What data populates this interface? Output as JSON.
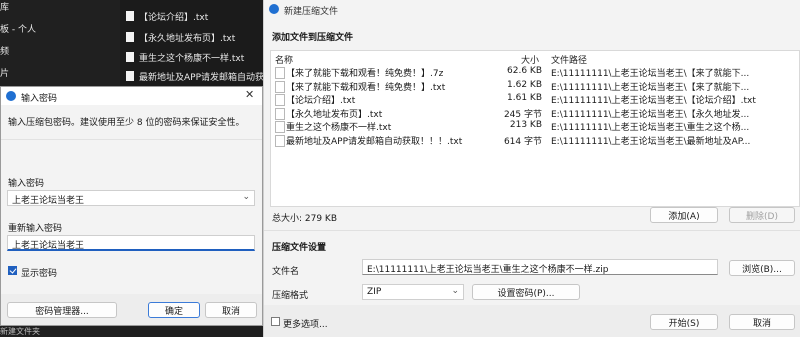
{
  "background": {
    "sidebar_items": [
      "库",
      "板 - 个人",
      "频",
      "片"
    ],
    "files": [
      "【论坛介绍】.txt",
      "【永久地址发布页】.txt",
      "重生之这个杨康不一样.txt",
      "最新地址及APP请发邮箱自动获取!"
    ],
    "status": "新建文件夹"
  },
  "main_dialog": {
    "title": "新建压缩文件",
    "add_section_title": "添加文件到压缩文件",
    "columns": {
      "name": "名称",
      "size": "大小",
      "path": "文件路径"
    },
    "rows": [
      {
        "name": "【来了就能下载和观看！纯免费！】.7z",
        "size": "62.6 KB",
        "path": "E:\\11111111\\上老王论坛当老王\\【来了就能下..."
      },
      {
        "name": "【来了就能下载和观看！纯免费！】.txt",
        "size": "1.62 KB",
        "path": "E:\\11111111\\上老王论坛当老王\\【来了就能下..."
      },
      {
        "name": "【论坛介绍】.txt",
        "size": "1.61 KB",
        "path": "E:\\11111111\\上老王论坛当老王\\【论坛介绍】.txt"
      },
      {
        "name": "【永久地址发布页】.txt",
        "size": "245 字节",
        "path": "E:\\11111111\\上老王论坛当老王\\【永久地址发..."
      },
      {
        "name": "重生之这个杨康不一样.txt",
        "size": "213 KB",
        "path": "E:\\11111111\\上老王论坛当老王\\重生之这个杨..."
      },
      {
        "name": "最新地址及APP请发邮箱自动获取！！！.txt",
        "size": "614 字节",
        "path": "E:\\11111111\\上老王论坛当老王\\最新地址及AP..."
      }
    ],
    "total_size": "总大小: 279 KB",
    "add_button": "添加(A)",
    "delete_button": "删除(D)",
    "settings_title": "压缩文件设置",
    "filename_label": "文件名",
    "filename_value": "E:\\11111111\\上老王论坛当老王\\重生之这个杨康不一样.zip",
    "browse_button": "浏览(B)...",
    "format_label": "压缩格式",
    "format_value": "ZIP",
    "set_password_button": "设置密码(P)...",
    "more_options": "更多选项...",
    "start_button": "开始(S)",
    "cancel_button": "取消"
  },
  "password_dialog": {
    "title": "输入密码",
    "description": "输入压缩包密码。建议使用至少 8 位的密码来保证安全性。",
    "password_label": "输入密码",
    "password_value": "上老王论坛当老王",
    "confirm_label": "重新输入密码",
    "confirm_value": "上老王论坛当老王",
    "show_password": "显示密码",
    "manager_button": "密码管理器...",
    "ok_button": "确定",
    "cancel_button": "取消"
  }
}
